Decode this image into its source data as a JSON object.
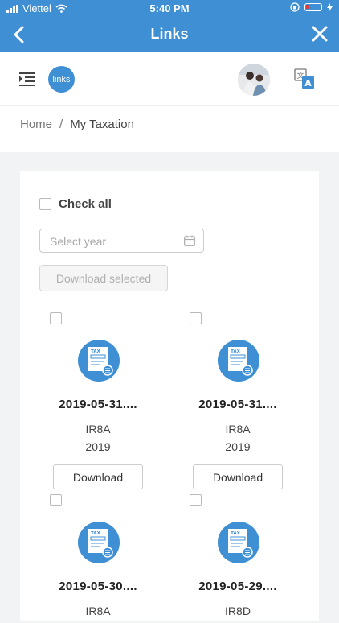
{
  "status": {
    "carrier": "Viettel",
    "time": "5:40 PM"
  },
  "nav": {
    "title": "Links"
  },
  "app": {
    "logo_text": "links"
  },
  "breadcrumb": {
    "home": "Home",
    "separator": "/",
    "current": "My Taxation"
  },
  "filters": {
    "check_all_label": "Check all",
    "year_placeholder": "Select year",
    "download_selected_label": "Download selected"
  },
  "documents": [
    {
      "name": "2019-05-31....",
      "type": "IR8A",
      "year": "2019",
      "button": "Download",
      "icon_text": "TAX"
    },
    {
      "name": "2019-05-31....",
      "type": "IR8A",
      "year": "2019",
      "button": "Download",
      "icon_text": "TAX"
    },
    {
      "name": "2019-05-30....",
      "type": "IR8A",
      "year": "",
      "button": "",
      "icon_text": "TAX"
    },
    {
      "name": "2019-05-29....",
      "type": "IR8D",
      "year": "",
      "button": "",
      "icon_text": "TAX"
    }
  ],
  "colors": {
    "brand": "#3e8fd4",
    "battery_low": "#e53935"
  }
}
